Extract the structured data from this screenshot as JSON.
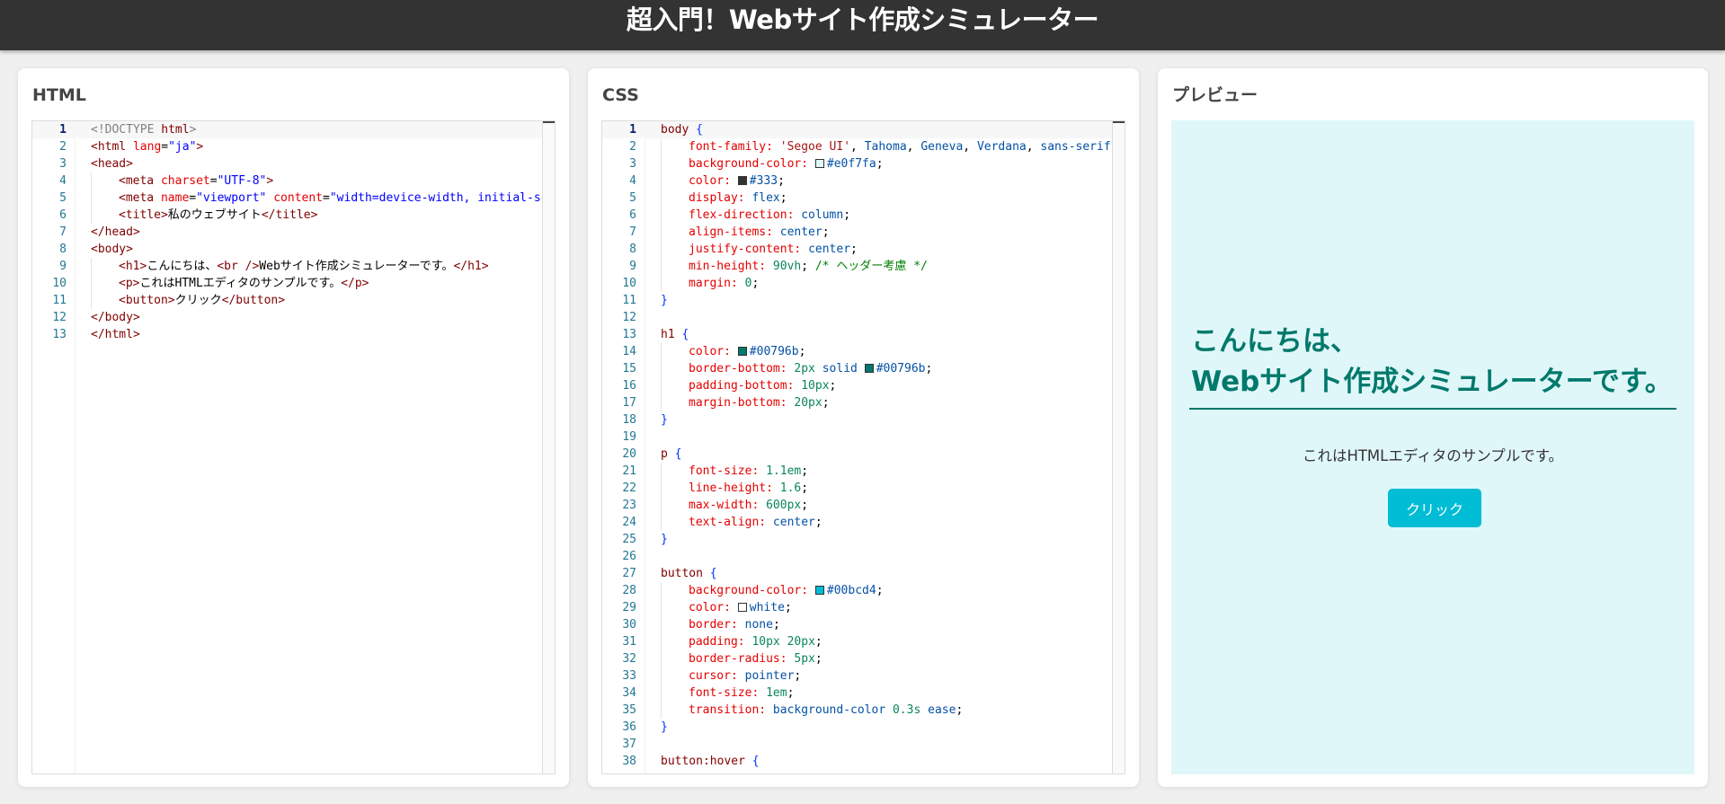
{
  "header": {
    "title": "超入門！Webサイト作成シミュレーター"
  },
  "panels": {
    "html": {
      "title": "HTML"
    },
    "css": {
      "title": "CSS"
    },
    "preview": {
      "title": "プレビュー"
    }
  },
  "html_editor": {
    "line_numbers": [
      "1",
      "2",
      "3",
      "4",
      "5",
      "6",
      "7",
      "8",
      "9",
      "10",
      "11",
      "12",
      "13"
    ],
    "lines": [
      "<!DOCTYPE html>",
      "<html lang=\"ja\">",
      "<head>",
      "    <meta charset=\"UTF-8\">",
      "    <meta name=\"viewport\" content=\"width=device-width, initial-scal",
      "    <title>私のウェブサイト</title>",
      "</head>",
      "<body>",
      "    <h1>こんにちは、<br />Webサイト作成シミュレーターです。</h1>",
      "    <p>これはHTMLエディタのサンプルです。</p>",
      "    <button>クリック</button>",
      "</body>",
      "</html>"
    ]
  },
  "css_editor": {
    "line_numbers": [
      "1",
      "2",
      "3",
      "4",
      "5",
      "6",
      "7",
      "8",
      "9",
      "10",
      "11",
      "12",
      "13",
      "14",
      "15",
      "16",
      "17",
      "18",
      "19",
      "20",
      "21",
      "22",
      "23",
      "24",
      "25",
      "26",
      "27",
      "28",
      "29",
      "30",
      "31",
      "32",
      "33",
      "34",
      "35",
      "36",
      "37",
      "38"
    ],
    "lines": [
      "body {",
      "    font-family: 'Segoe UI', Tahoma, Geneva, Verdana, sans-serif;",
      "    background-color: #e0f7fa;",
      "    color: #333;",
      "    display: flex;",
      "    flex-direction: column;",
      "    align-items: center;",
      "    justify-content: center;",
      "    min-height: 90vh; /* ヘッダー考慮 */",
      "    margin: 0;",
      "}",
      "",
      "h1 {",
      "    color: #00796b;",
      "    border-bottom: 2px solid #00796b;",
      "    padding-bottom: 10px;",
      "    margin-bottom: 20px;",
      "}",
      "",
      "p {",
      "    font-size: 1.1em;",
      "    line-height: 1.6;",
      "    max-width: 600px;",
      "    text-align: center;",
      "}",
      "",
      "button {",
      "    background-color: #00bcd4;",
      "    color: white;",
      "    border: none;",
      "    padding: 10px 20px;",
      "    border-radius: 5px;",
      "    cursor: pointer;",
      "    font-size: 1em;",
      "    transition: background-color 0.3s ease;",
      "}",
      "",
      "button:hover {"
    ]
  },
  "preview": {
    "h1_line1": "こんにちは、",
    "h1_line2": "Webサイト作成シミュレーターです。",
    "paragraph": "これはHTMLエディタのサンプルです。",
    "button_label": "クリック"
  },
  "colors": {
    "header_bg": "#333333",
    "preview_bg": "#e0f7fa",
    "h1_color": "#00796b",
    "button_bg": "#00bcd4"
  }
}
